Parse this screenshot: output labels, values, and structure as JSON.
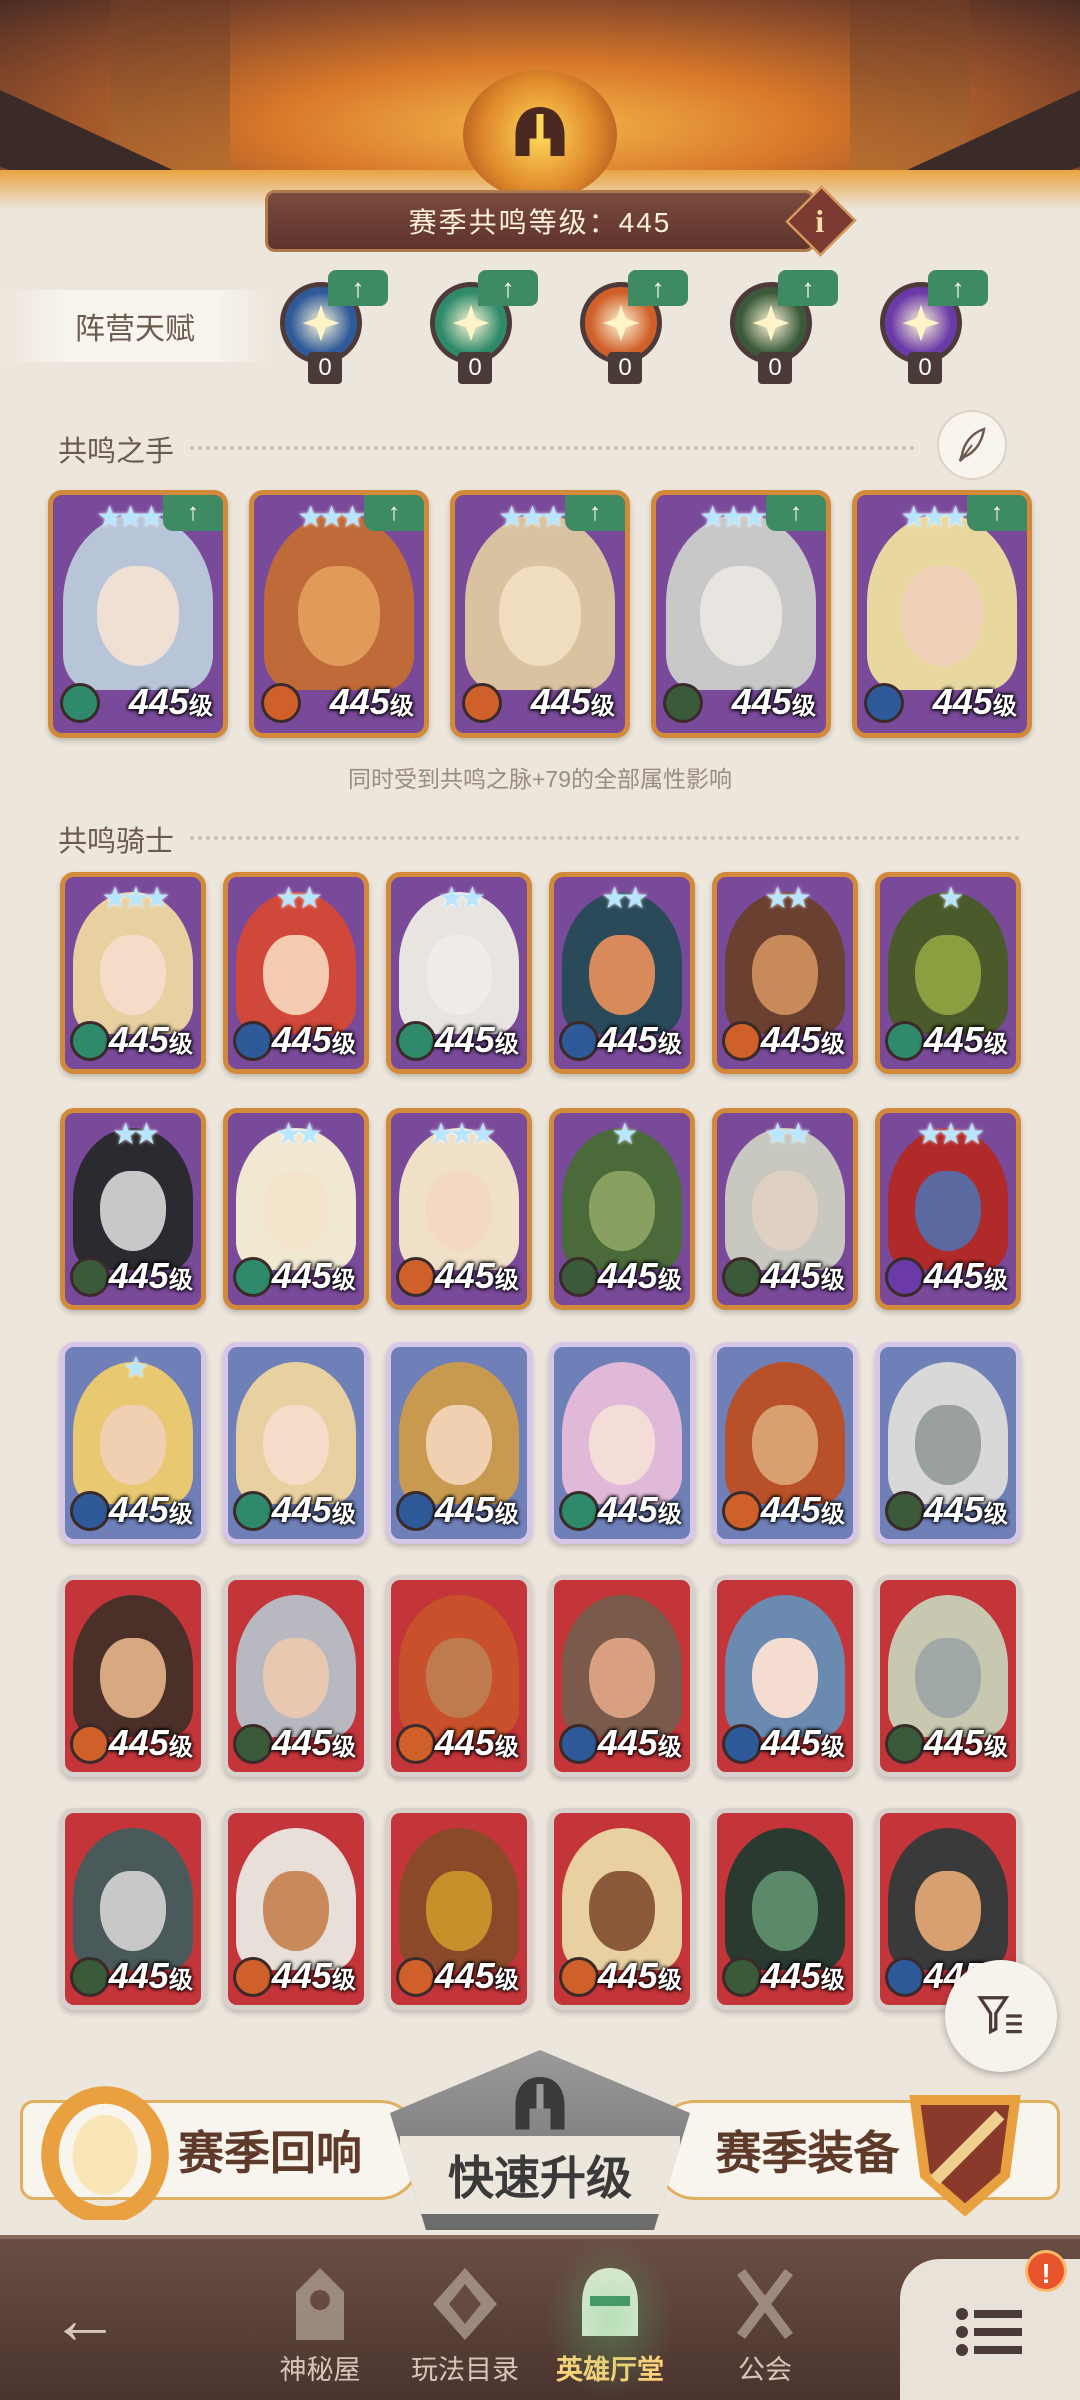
{
  "header": {
    "season_level_text": "赛季共鸣等级：445",
    "info_label": "i"
  },
  "faction_talent": {
    "label": "阵营天赋",
    "items": [
      {
        "name": "lightbearer",
        "count": "0",
        "color": "#2f5a9a",
        "icon": "star-compass-icon"
      },
      {
        "name": "wilder",
        "count": "0",
        "color": "#2e8a6a",
        "icon": "leaf-icon"
      },
      {
        "name": "mauler",
        "count": "0",
        "color": "#d0602a",
        "icon": "flame-icon"
      },
      {
        "name": "graveborn",
        "count": "0",
        "color": "#3a5a3a",
        "icon": "eye-icon"
      },
      {
        "name": "celestial",
        "count": "0",
        "color": "#6a3aa8",
        "icon": "sun-star-icon"
      }
    ],
    "up_arrow": "↑"
  },
  "resonance_hands": {
    "title": "共鸣之手",
    "note": "同时受到共鸣之脉+79的全部属性影响",
    "level_num": "445",
    "level_unit": "级"
  },
  "resonance_knights": {
    "title": "共鸣骑士",
    "level_num": "445",
    "level_unit": "级"
  },
  "hand_cards": [
    {
      "stars": "★★★★",
      "portrait": "#b8c4d8",
      "face": "#f0e0d4",
      "fac": "#2e8a6a"
    },
    {
      "stars": "★★★★",
      "portrait": "#c06a3a",
      "face": "#e09a5a",
      "fac": "#d0602a"
    },
    {
      "stars": "★★★★",
      "portrait": "#d8c2a0",
      "face": "#f0ddc0",
      "fac": "#d0602a"
    },
    {
      "stars": "★★★★",
      "portrait": "#c8c8c8",
      "face": "#e8e4e0",
      "fac": "#3a5a3a"
    },
    {
      "stars": "★★★★",
      "portrait": "#e8d8a0",
      "face": "#f0d0b8",
      "fac": "#2f5a9a"
    }
  ],
  "knight_rows": [
    [
      {
        "tier": "gold",
        "stars": "★★★",
        "portrait": "#e8d0a0",
        "face": "#f4dcc8",
        "fac": "#2e8a6a"
      },
      {
        "tier": "gold",
        "stars": "★★",
        "portrait": "#d0483a",
        "face": "#f4cbb0",
        "fac": "#2f5a9a"
      },
      {
        "tier": "gold",
        "stars": "★★",
        "portrait": "#e8e4e0",
        "face": "#f0ece8",
        "fac": "#2e8a6a"
      },
      {
        "tier": "gold",
        "stars": "★★",
        "portrait": "#2a4a5a",
        "face": "#d88a5a",
        "fac": "#2f5a9a"
      },
      {
        "tier": "gold",
        "stars": "★★",
        "portrait": "#6a4030",
        "face": "#c88a5a",
        "fac": "#d0602a"
      },
      {
        "tier": "gold",
        "stars": "★",
        "portrait": "#4a5a2a",
        "face": "#8aa040",
        "fac": "#2e8a6a"
      }
    ],
    [
      {
        "tier": "gold",
        "stars": "★★",
        "portrait": "#2a2a30",
        "face": "#c8c8c8",
        "fac": "#3a5a3a"
      },
      {
        "tier": "gold",
        "stars": "★★",
        "portrait": "#f0e8d0",
        "face": "#f4e4cc",
        "fac": "#2e8a6a"
      },
      {
        "tier": "gold",
        "stars": "★★★",
        "portrait": "#f0e0c8",
        "face": "#f4d8c4",
        "fac": "#d0602a"
      },
      {
        "tier": "gold",
        "stars": "★",
        "portrait": "#4a6a3a",
        "face": "#8aa060",
        "fac": "#3a5a3a"
      },
      {
        "tier": "gold",
        "stars": "★★",
        "portrait": "#c8c8c0",
        "face": "#e0d0c4",
        "fac": "#3a5a3a"
      },
      {
        "tier": "gold",
        "stars": "★★★",
        "portrait": "#b02a2a",
        "face": "#5a6aa0",
        "fac": "#6a3aa8"
      }
    ],
    [
      {
        "tier": "silver",
        "stars": "★",
        "portrait": "#e8c870",
        "face": "#f0d0b0",
        "fac": "#2f5a9a"
      },
      {
        "tier": "silver",
        "stars": "",
        "portrait": "#e8d0a0",
        "face": "#f4dcc8",
        "fac": "#2e8a6a"
      },
      {
        "tier": "silver",
        "stars": "",
        "portrait": "#c89a50",
        "face": "#f0d0b0",
        "fac": "#2f5a9a"
      },
      {
        "tier": "silver",
        "stars": "",
        "portrait": "#e0b8d8",
        "face": "#f4dcd8",
        "fac": "#2e8a6a"
      },
      {
        "tier": "silver",
        "stars": "",
        "portrait": "#b8502a",
        "face": "#d8a070",
        "fac": "#d0602a"
      },
      {
        "tier": "silver",
        "stars": "",
        "portrait": "#d8d8d8",
        "face": "#9aa0a0",
        "fac": "#3a5a3a"
      }
    ],
    [
      {
        "tier": "red",
        "stars": "",
        "portrait": "#4a3028",
        "face": "#d8a880",
        "fac": "#d0602a"
      },
      {
        "tier": "red",
        "stars": "",
        "portrait": "#b8b8c0",
        "face": "#e8c8b0",
        "fac": "#3a5a3a"
      },
      {
        "tier": "red",
        "stars": "",
        "portrait": "#c8502a",
        "face": "#c07a50",
        "fac": "#d0602a"
      },
      {
        "tier": "red",
        "stars": "",
        "portrait": "#7a5a4a",
        "face": "#d8a080",
        "fac": "#2f5a9a"
      },
      {
        "tier": "red",
        "stars": "",
        "portrait": "#6a8ab0",
        "face": "#f4dcd0",
        "fac": "#2f5a9a"
      },
      {
        "tier": "red",
        "stars": "",
        "portrait": "#c8c8b0",
        "face": "#a0a8a8",
        "fac": "#3a5a3a"
      }
    ],
    [
      {
        "tier": "red",
        "stars": "",
        "portrait": "#4a5a5a",
        "face": "#c8c8c8",
        "fac": "#3a5a3a"
      },
      {
        "tier": "red",
        "stars": "",
        "portrait": "#e8e0d8",
        "face": "#c88a5a",
        "fac": "#d0602a"
      },
      {
        "tier": "red",
        "stars": "",
        "portrait": "#8a4a2a",
        "face": "#c8902a",
        "fac": "#d0602a"
      },
      {
        "tier": "red",
        "stars": "",
        "portrait": "#e8d0a0",
        "face": "#8a5a3a",
        "fac": "#d0602a"
      },
      {
        "tier": "red",
        "stars": "",
        "portrait": "#2a3a30",
        "face": "#5a8a6a",
        "fac": "#3a5a3a"
      },
      {
        "tier": "red",
        "stars": "",
        "portrait": "#3a3a3a",
        "face": "#d8a070",
        "fac": "#2f5a9a"
      }
    ]
  ],
  "actions": {
    "season_echo": "赛季回响",
    "quick_upgrade": "快速升级",
    "season_gear": "赛季装备"
  },
  "nav": {
    "mystery_shop": "神秘屋",
    "modes": "玩法目录",
    "hero_hall": "英雄厅堂",
    "guild": "公会",
    "alert": "!"
  },
  "colors": {
    "accent_green": "#3e8a62",
    "header_brown": "#5e342c",
    "background": "#ece6dc"
  }
}
